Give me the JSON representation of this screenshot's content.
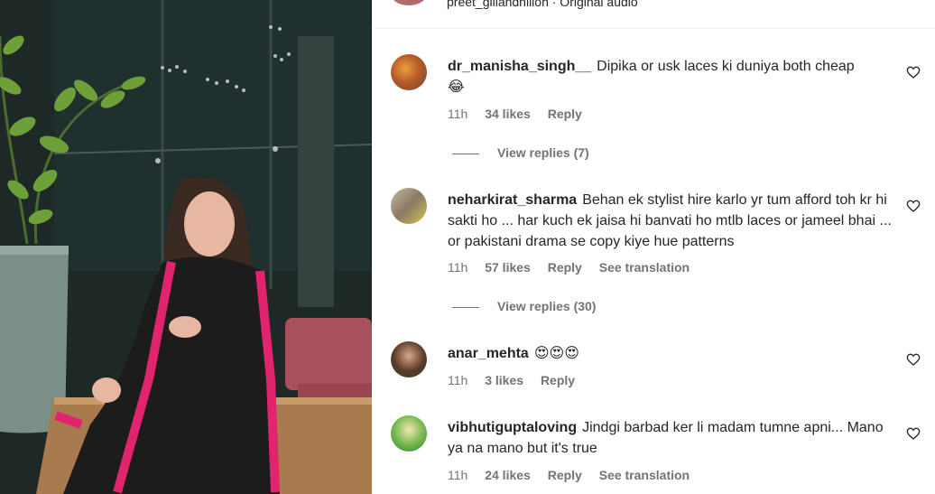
{
  "header": {
    "user_line": "preet_gillandhillon · Original audio"
  },
  "comments": [
    {
      "username": "dr_manisha_singh__",
      "text": "Dipika or usk laces ki duniya both cheap",
      "emoji": "😂",
      "time": "11h",
      "likes": "34 likes",
      "reply": "Reply",
      "translate": "",
      "view_replies": "View replies (7)"
    },
    {
      "username": "neharkirat_sharma",
      "text": "Behan ek stylist hire karlo yr tum afford toh kr hi sakti ho ... har kuch ek jaisa hi banvati ho mtlb laces or jameel bhai ... or pakistani drama se copy kiye hue patterns",
      "emoji": "",
      "time": "11h",
      "likes": "57 likes",
      "reply": "Reply",
      "translate": "See translation",
      "view_replies": "View replies (30)"
    },
    {
      "username": "anar_mehta",
      "text": "",
      "emoji": "😍😍😍",
      "time": "11h",
      "likes": "3 likes",
      "reply": "Reply",
      "translate": "",
      "view_replies": ""
    },
    {
      "username": "vibhutiguptaloving",
      "text": "Jindgi barbad ker li madam tumne apni... Mano ya na mano but it's true",
      "emoji": "",
      "time": "11h",
      "likes": "24 likes",
      "reply": "Reply",
      "translate": "See translation",
      "view_replies": ""
    }
  ],
  "colors": {
    "text": "#262626",
    "meta": "#737373",
    "saree": "#1a1a1a",
    "border": "#e0246e"
  }
}
